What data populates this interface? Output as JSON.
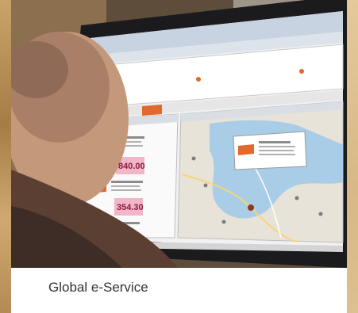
{
  "caption": "Global e-Service",
  "screen": {
    "prices": [
      "840.00",
      "354.30"
    ]
  },
  "colors": {
    "accent_orange": "#e2682b",
    "price_pink": "#f2b6c9",
    "map_water": "#a9cde6",
    "map_land": "#e8e3d8"
  }
}
